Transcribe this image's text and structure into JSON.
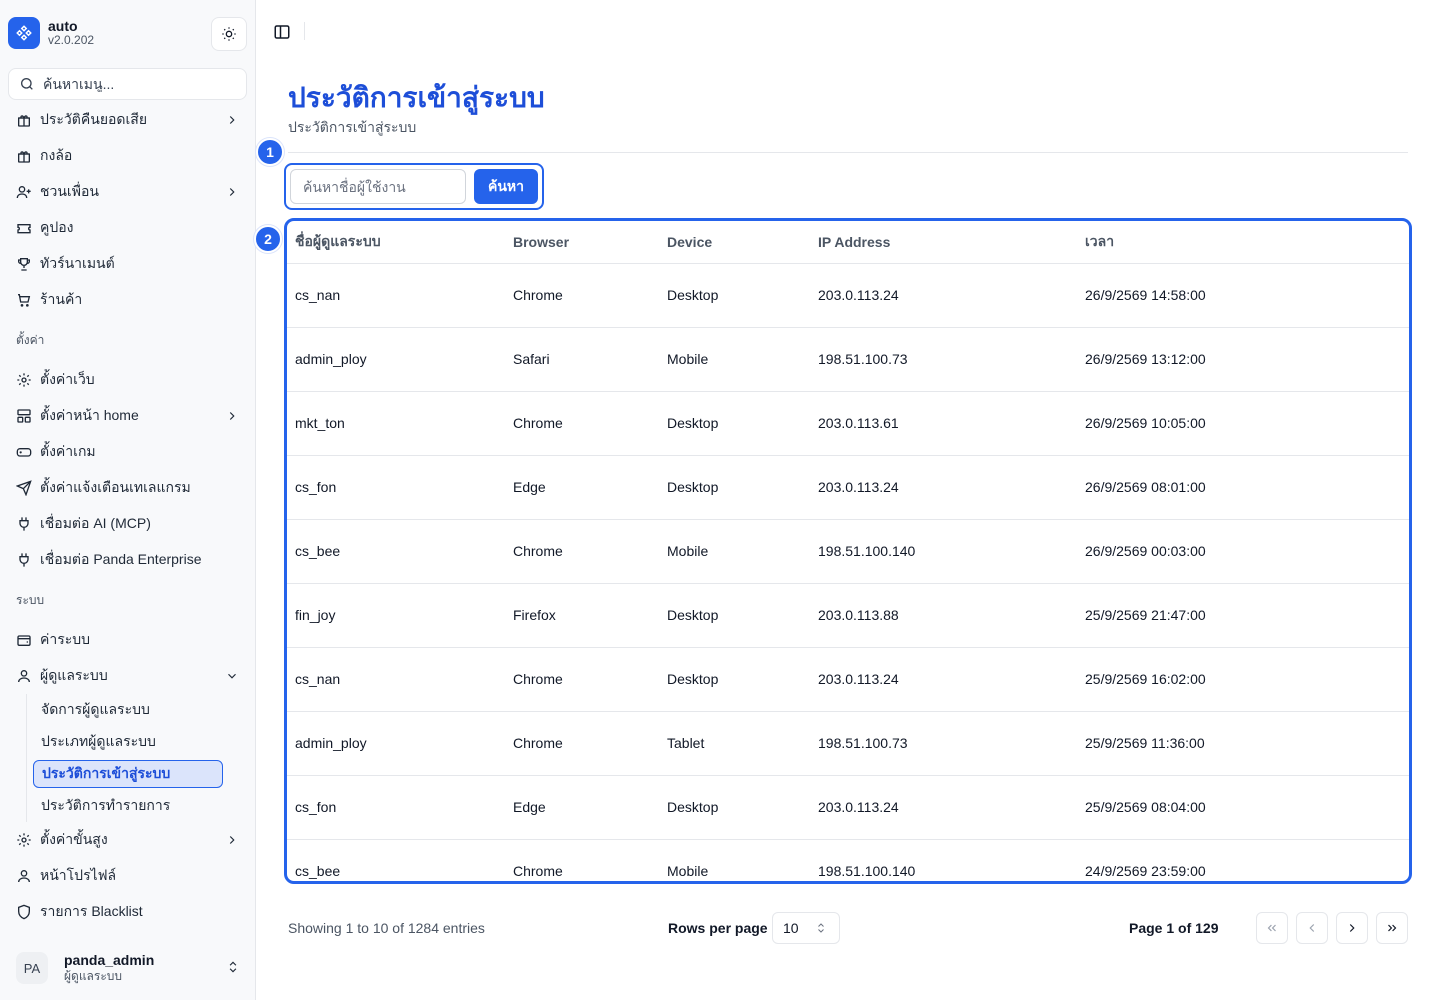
{
  "brand": {
    "name": "auto",
    "version": "v2.0.202",
    "accent": "#2563eb"
  },
  "menu_search": {
    "placeholder": "ค้นหาเมนู..."
  },
  "nav": {
    "top_items": [
      {
        "label": "ประวัติคืนยอดเสีย",
        "icon": "gift-icon",
        "has_chevron": true
      },
      {
        "label": "กงล้อ",
        "icon": "gift-icon",
        "has_chevron": false
      },
      {
        "label": "ชวนเพื่อน",
        "icon": "user-plus-icon",
        "has_chevron": true
      },
      {
        "label": "คูปอง",
        "icon": "ticket-icon",
        "has_chevron": false
      },
      {
        "label": "ทัวร์นาเมนต์",
        "icon": "trophy-icon",
        "has_chevron": false
      },
      {
        "label": "ร้านค้า",
        "icon": "cart-icon",
        "has_chevron": false
      }
    ],
    "section_settings": "ตั้งค่า",
    "settings_items": [
      {
        "label": "ตั้งค่าเว็บ",
        "icon": "gear-icon",
        "has_chevron": false
      },
      {
        "label": "ตั้งค่าหน้า home",
        "icon": "layout-icon",
        "has_chevron": true
      },
      {
        "label": "ตั้งค่าเกม",
        "icon": "gamepad-icon",
        "has_chevron": false
      },
      {
        "label": "ตั้งค่าแจ้งเตือนเทเลแกรม",
        "icon": "send-icon",
        "has_chevron": false
      },
      {
        "label": "เชื่อมต่อ AI (MCP)",
        "icon": "plug-icon",
        "has_chevron": false
      },
      {
        "label": "เชื่อมต่อ Panda Enterprise",
        "icon": "plug-icon",
        "has_chevron": false
      }
    ],
    "section_system": "ระบบ",
    "system_items": [
      {
        "label": "ค่าระบบ",
        "icon": "wallet-icon"
      }
    ],
    "admin_group": {
      "label": "ผู้ดูแลระบบ",
      "sub_items": [
        "จัดการผู้ดูแลระบบ",
        "ประเภทผู้ดูแลระบบ",
        "ประวัติการเข้าสู่ระบบ",
        "ประวัติการทำรายการ"
      ],
      "active_index": 2
    },
    "bottom_items": [
      {
        "label": "ตั้งค่าขั้นสูง",
        "icon": "gear-icon",
        "has_chevron": true
      },
      {
        "label": "หน้าโปรไฟล์",
        "icon": "user-icon",
        "has_chevron": false
      },
      {
        "label": "รายการ Blacklist",
        "icon": "shield-icon",
        "has_chevron": false
      }
    ]
  },
  "user": {
    "initials": "PA",
    "name": "panda_admin",
    "role": "ผู้ดูแลระบบ"
  },
  "page": {
    "title": "ประวัติการเข้าสู่ระบบ",
    "subtitle": "ประวัติการเข้าสู่ระบบ"
  },
  "annotations": {
    "badge1": "1",
    "badge2": "2"
  },
  "search": {
    "placeholder": "ค้นหาชื่อผู้ใช้งาน",
    "button": "ค้นหา",
    "value": ""
  },
  "table": {
    "columns": [
      "ชื่อผู้ดูแลระบบ",
      "Browser",
      "Device",
      "IP Address",
      "เวลา"
    ],
    "rows": [
      [
        "cs_nan",
        "Chrome",
        "Desktop",
        "203.0.113.24",
        "26/9/2569 14:58:00"
      ],
      [
        "admin_ploy",
        "Safari",
        "Mobile",
        "198.51.100.73",
        "26/9/2569 13:12:00"
      ],
      [
        "mkt_ton",
        "Chrome",
        "Desktop",
        "203.0.113.61",
        "26/9/2569 10:05:00"
      ],
      [
        "cs_fon",
        "Edge",
        "Desktop",
        "203.0.113.24",
        "26/9/2569 08:01:00"
      ],
      [
        "cs_bee",
        "Chrome",
        "Mobile",
        "198.51.100.140",
        "26/9/2569 00:03:00"
      ],
      [
        "fin_joy",
        "Firefox",
        "Desktop",
        "203.0.113.88",
        "25/9/2569 21:47:00"
      ],
      [
        "cs_nan",
        "Chrome",
        "Desktop",
        "203.0.113.24",
        "25/9/2569 16:02:00"
      ],
      [
        "admin_ploy",
        "Chrome",
        "Tablet",
        "198.51.100.73",
        "25/9/2569 11:36:00"
      ],
      [
        "cs_fon",
        "Edge",
        "Desktop",
        "203.0.113.24",
        "25/9/2569 08:04:00"
      ],
      [
        "cs_bee",
        "Chrome",
        "Mobile",
        "198.51.100.140",
        "24/9/2569 23:59:00"
      ]
    ]
  },
  "pagination": {
    "info": "Showing 1 to 10 of 1284 entries",
    "rows_label": "Rows per page",
    "rows_value": "10",
    "page_label": "Page 1 of 129"
  }
}
